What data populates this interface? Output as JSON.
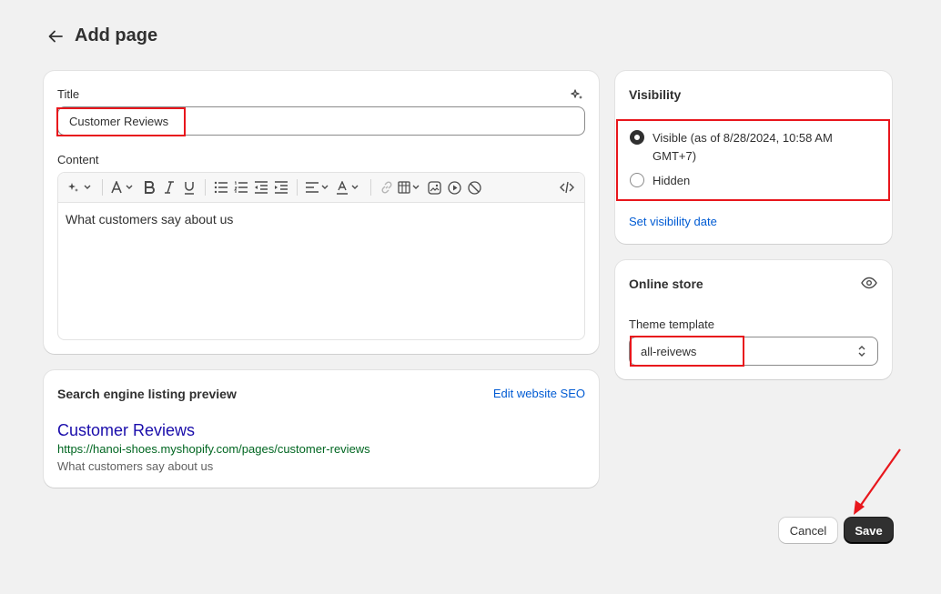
{
  "header": {
    "title": "Add page"
  },
  "main": {
    "title_label": "Title",
    "title_value": "Customer Reviews",
    "content_label": "Content",
    "content_text": "What customers say about us"
  },
  "seo": {
    "heading": "Search engine listing preview",
    "edit_link": "Edit website SEO",
    "page_title": "Customer Reviews",
    "url": "https://hanoi-shoes.myshopify.com/pages/customer-reviews",
    "description": "What customers say about us"
  },
  "visibility": {
    "heading": "Visibility",
    "options": [
      {
        "label": "Visible (as of 8/28/2024, 10:58 AM GMT+7)",
        "checked": true
      },
      {
        "label": "Hidden",
        "checked": false
      }
    ],
    "set_date_link": "Set visibility date"
  },
  "online_store": {
    "heading": "Online store",
    "theme_label": "Theme template",
    "theme_value": "all-reivews"
  },
  "actions": {
    "cancel": "Cancel",
    "save": "Save"
  },
  "colors": {
    "annotation": "#e8161c",
    "link": "#005bd3",
    "primary": "#303030"
  }
}
